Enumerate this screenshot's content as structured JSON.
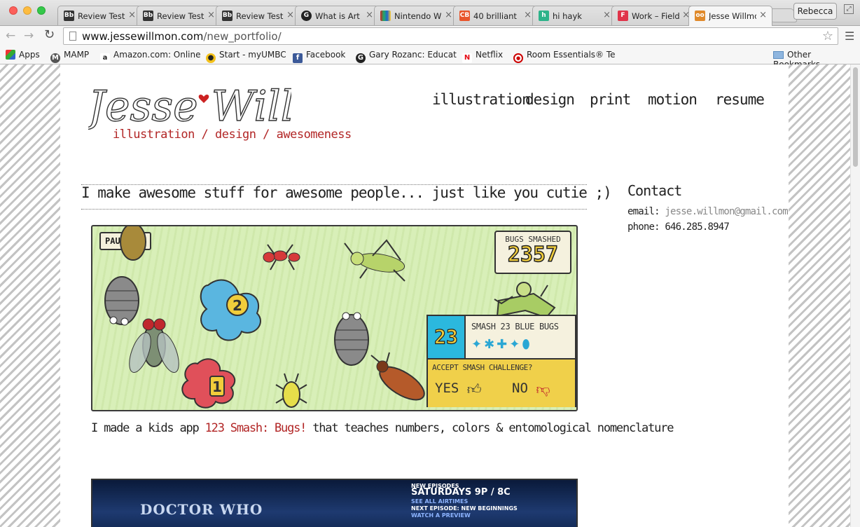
{
  "browser": {
    "tabs": [
      {
        "title": "Review Test",
        "icon": "blackboard-icon",
        "color": "#333333"
      },
      {
        "title": "Review Test",
        "icon": "blackboard-icon",
        "color": "#333333"
      },
      {
        "title": "Review Test",
        "icon": "blackboard-icon",
        "color": "#333333"
      },
      {
        "title": "What is Art",
        "icon": "site-logo-icon",
        "color": "#222222"
      },
      {
        "title": "Nintendo W",
        "icon": "nintendo-icon",
        "color": "#cc2222"
      },
      {
        "title": "40 brilliant",
        "icon": "creative-bloq-icon",
        "color": "#e8552b"
      },
      {
        "title": "hi hayk",
        "icon": "houzz-icon",
        "color": "#2db38a"
      },
      {
        "title": "Work – Field",
        "icon": "f-icon",
        "color": "#e0344a"
      },
      {
        "title": "Jesse Willmon",
        "icon": "owl-icon",
        "color": "#e08a2b",
        "active": true
      }
    ],
    "profile_name": "Rebecca",
    "url_host": "www.jessewillmon.com",
    "url_path": "/new_portfolio/",
    "bookmarks": [
      {
        "label": "Apps",
        "icon": "apps-grid-icon"
      },
      {
        "label": "MAMP",
        "icon": "mamp-icon"
      },
      {
        "label": "Amazon.com: Online",
        "icon": "amazon-icon"
      },
      {
        "label": "Start - myUMBC",
        "icon": "paw-icon"
      },
      {
        "label": "Facebook",
        "icon": "facebook-icon"
      },
      {
        "label": "Gary Rozanc: Educat",
        "icon": "site-logo-icon"
      },
      {
        "label": "Netflix",
        "icon": "netflix-icon"
      },
      {
        "label": "Room Essentials® Te",
        "icon": "target-icon"
      }
    ],
    "other_bookmarks": "Other Bookmarks"
  },
  "site": {
    "logo_text": "Jesse Willmon",
    "tagline": "illustration / design / awesomeness",
    "nav": [
      "illustration",
      "design",
      "print",
      "motion",
      "resume"
    ],
    "headline": "I make awesome stuff for awesome people... just like you cutie ;)",
    "contact": {
      "title": "Contact",
      "email_label": "email:",
      "email": "jesse.willmon@gmail.com",
      "phone_label": "phone:",
      "phone": "646.285.8947"
    },
    "game": {
      "pause": "PAUSE",
      "score_label": "BUGS SMASHED",
      "score": "2357",
      "challenge_number": "23",
      "challenge_text": "SMASH 23 BLUE BUGS",
      "accept_text": "ACCEPT SMASH CHALLENGE?",
      "yes": "YES",
      "no": "NO",
      "bug_badge_1": "1",
      "bug_badge_2": "2"
    },
    "caption_before": "I made a kids app ",
    "caption_link": "123 Smash: Bugs!",
    "caption_after": " that teaches numbers, colors & entomological nomenclature",
    "tv": {
      "logo": "DOCTOR WHO",
      "line1": "NEW EPISODES",
      "line2": "SATURDAYS 9P / 8C",
      "line3": "SEE ALL AIRTIMES",
      "line4": "NEXT EPISODE: NEW BEGINNINGS",
      "line5": "WATCH A PREVIEW"
    }
  }
}
